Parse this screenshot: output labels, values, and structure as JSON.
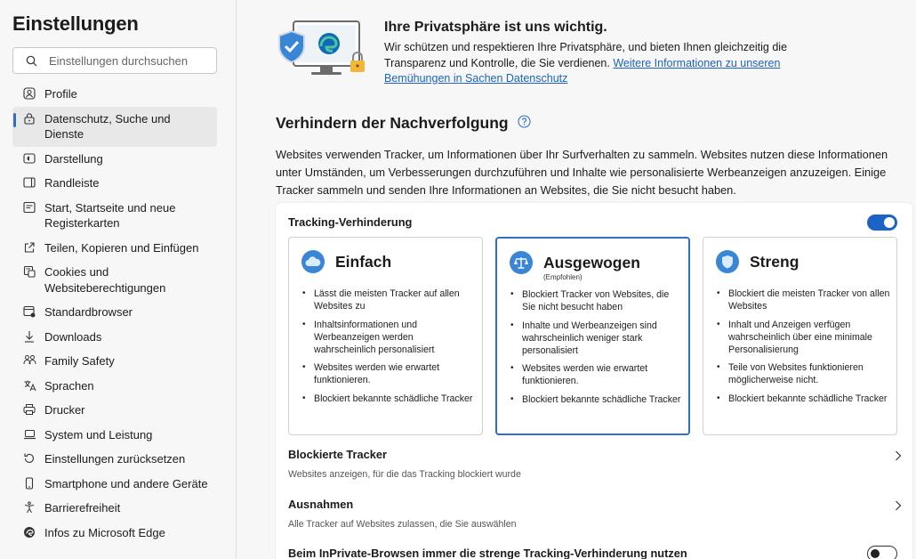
{
  "sidebar": {
    "title": "Einstellungen",
    "search_placeholder": "Einstellungen durchsuchen",
    "items": [
      {
        "label": "Profile",
        "icon": "profile-icon"
      },
      {
        "label": "Datenschutz, Suche und Dienste",
        "icon": "lock-icon",
        "active": true
      },
      {
        "label": "Darstellung",
        "icon": "appearance-icon"
      },
      {
        "label": "Randleiste",
        "icon": "sidebar-panel-icon"
      },
      {
        "label": "Start, Startseite und neue Registerkarten",
        "icon": "home-icon"
      },
      {
        "label": "Teilen, Kopieren und Einfügen",
        "icon": "share-icon"
      },
      {
        "label": "Cookies und Websiteberechtigungen",
        "icon": "cookies-icon"
      },
      {
        "label": "Standardbrowser",
        "icon": "browser-icon"
      },
      {
        "label": "Downloads",
        "icon": "download-icon"
      },
      {
        "label": "Family Safety",
        "icon": "family-icon"
      },
      {
        "label": "Sprachen",
        "icon": "language-icon"
      },
      {
        "label": "Drucker",
        "icon": "printer-icon"
      },
      {
        "label": "System und Leistung",
        "icon": "laptop-icon"
      },
      {
        "label": "Einstellungen zurücksetzen",
        "icon": "reset-icon"
      },
      {
        "label": "Smartphone und andere Geräte",
        "icon": "phone-icon"
      },
      {
        "label": "Barrierefreiheit",
        "icon": "accessibility-icon"
      },
      {
        "label": "Infos zu Microsoft Edge",
        "icon": "edge-icon"
      }
    ]
  },
  "hero": {
    "title": "Ihre Privatsphäre ist uns wichtig.",
    "text": "Wir schützen und respektieren Ihre Privatsphäre, und bieten Ihnen gleichzeitig die Transparenz und Kontrolle, die Sie verdienen.",
    "link": "Weitere Informationen zu unseren Bemühungen in Sachen Datenschutz"
  },
  "tracking": {
    "title": "Verhindern der Nachverfolgung",
    "description": "Websites verwenden Tracker, um Informationen über Ihr Surfverhalten zu sammeln. Websites nutzen diese Informationen unter Umständen, um Verbesserungen durchzuführen und Inhalte wie personalisierte Werbeanzeigen anzuzeigen. Einige Tracker sammeln und senden Ihre Informationen an Websites, die Sie nicht besucht haben.",
    "prevention_label": "Tracking-Verhinderung",
    "prevention_enabled": true,
    "accent_color": "#1b63c4",
    "cards": [
      {
        "name": "Einfach",
        "subtitle": "",
        "selected": false,
        "bullets": [
          "Lässt die meisten Tracker auf allen Websites zu",
          "Inhaltsinformationen und Werbeanzeigen werden wahrscheinlich personalisiert",
          "Websites werden wie erwartet funktionieren.",
          "Blockiert bekannte schädliche Tracker"
        ]
      },
      {
        "name": "Ausgewogen",
        "subtitle": "(Empfohlen)",
        "selected": true,
        "bullets": [
          "Blockiert Tracker von Websites, die Sie nicht besucht haben",
          "Inhalte und Werbeanzeigen sind wahrscheinlich weniger stark personalisiert",
          "Websites werden wie erwartet funktionieren.",
          "Blockiert bekannte schädliche Tracker"
        ]
      },
      {
        "name": "Streng",
        "subtitle": "",
        "selected": false,
        "bullets": [
          "Blockiert die meisten Tracker von allen Websites",
          "Inhalt und Anzeigen verfügen wahrscheinlich über eine minimale Personalisierung",
          "Teile von Websites funktionieren möglicherweise nicht.",
          "Blockiert bekannte schädliche Tracker"
        ]
      }
    ],
    "blocked": {
      "title": "Blockierte Tracker",
      "desc": "Websites anzeigen, für die das Tracking blockiert wurde"
    },
    "exceptions": {
      "title": "Ausnahmen",
      "desc": "Alle Tracker auf Websites zulassen, die Sie auswählen"
    },
    "inprivate": {
      "title": "Beim InPrivate-Browsen immer die strenge Tracking-Verhinderung nutzen",
      "enabled": false
    }
  }
}
